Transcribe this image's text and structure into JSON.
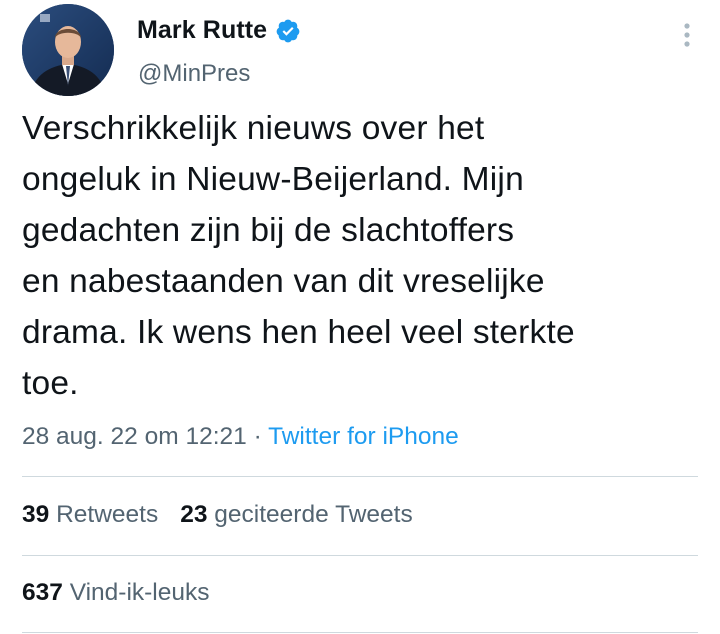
{
  "author": {
    "display_name": "Mark Rutte",
    "handle": "@MinPres",
    "verified_icon": "verified-badge-icon",
    "avatar_icon": "profile-photo"
  },
  "more_icon": "more-vertical-icon",
  "tweet": {
    "text": "Verschrikkelijk nieuws over het\nongeluk in Nieuw-Beijerland. Mijn\ngedachten zijn bij de slachtoffers\nen nabestaanden van dit vreselijke\ndrama. Ik wens hen heel veel sterkte\ntoe."
  },
  "meta": {
    "timestamp": "28 aug. 22 om 12:21",
    "separator": " · ",
    "source": "Twitter for iPhone"
  },
  "stats": {
    "retweets_count": "39",
    "retweets_label": "Retweets",
    "quotes_count": "23",
    "quotes_label": "geciteerde Tweets",
    "likes_count": "637",
    "likes_label": "Vind-ik-leuks"
  },
  "colors": {
    "accent": "#1d9bf0",
    "secondary_text": "#536471",
    "primary_text": "#0f1419",
    "divider": "#cfd9de"
  }
}
